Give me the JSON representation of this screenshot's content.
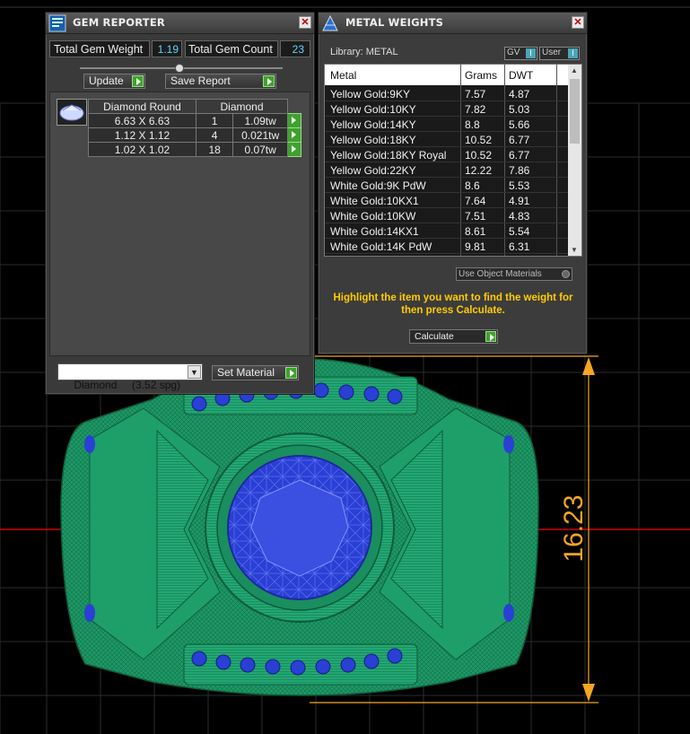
{
  "gem_reporter": {
    "title": "GEM REPORTER",
    "total_gem_weight_label": "Total Gem Weight",
    "total_gem_weight_value": "1.19",
    "total_gem_count_label": "Total Gem Count",
    "total_gem_count_value": "23",
    "update_label": "Update",
    "save_report_label": "Save Report",
    "table_header_shape": "Diamond Round",
    "table_header_material": "Diamond",
    "rows": [
      {
        "size": "6.63 X 6.63",
        "count": "1",
        "weight": "1.09tw"
      },
      {
        "size": "1.12 X 1.12",
        "count": "4",
        "weight": "0.021tw"
      },
      {
        "size": "1.02 X 1.02",
        "count": "18",
        "weight": "0.07tw"
      }
    ],
    "material_select_value": "Diamond     (3.52 spg)",
    "set_material_label": "Set Material"
  },
  "metal_weights": {
    "title": "METAL WEIGHTS",
    "library_label": "Library: METAL",
    "gv_label": "GV",
    "user_label": "User",
    "columns": [
      "Metal",
      "Grams",
      "DWT"
    ],
    "rows": [
      {
        "metal": "Yellow Gold:9KY",
        "grams": "7.57",
        "dwt": "4.87"
      },
      {
        "metal": "Yellow Gold:10KY",
        "grams": "7.82",
        "dwt": "5.03"
      },
      {
        "metal": "Yellow Gold:14KY",
        "grams": "8.8",
        "dwt": "5.66"
      },
      {
        "metal": "Yellow Gold:18KY",
        "grams": "10.52",
        "dwt": "6.77"
      },
      {
        "metal": "Yellow Gold:18KY Royal",
        "grams": "10.52",
        "dwt": "6.77"
      },
      {
        "metal": "Yellow Gold:22KY",
        "grams": "12.22",
        "dwt": "7.86"
      },
      {
        "metal": "White Gold:9K PdW",
        "grams": "8.6",
        "dwt": "5.53"
      },
      {
        "metal": "White Gold:10KX1",
        "grams": "7.64",
        "dwt": "4.91"
      },
      {
        "metal": "White Gold:10KW",
        "grams": "7.51",
        "dwt": "4.83"
      },
      {
        "metal": "White Gold:14KX1",
        "grams": "8.61",
        "dwt": "5.54"
      },
      {
        "metal": "White Gold:14K PdW",
        "grams": "9.81",
        "dwt": "6.31"
      }
    ],
    "use_object_materials_label": "Use Object Materials",
    "instruction": "Highlight the item you want to find the weight for then press Calculate.",
    "calculate_label": "Calculate"
  },
  "viewport": {
    "dimension_value": "16.23",
    "colors": {
      "ring": "#1f9c6a",
      "stone": "#2a3fd4",
      "dimension": "#f5a623",
      "axis": "#d40000",
      "grid": "#2c2c2c"
    }
  }
}
